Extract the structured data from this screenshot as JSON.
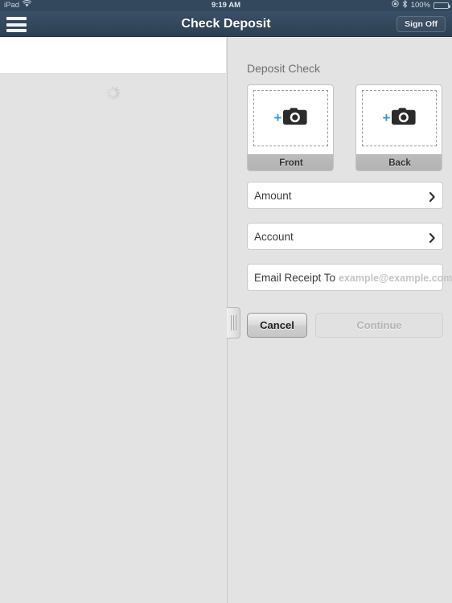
{
  "status_bar": {
    "device": "iPad",
    "wifi_icon": "wifi-icon",
    "time": "9:19 AM",
    "rotation_lock_icon": "rotation-lock-icon",
    "bluetooth_icon": "bluetooth-icon",
    "battery_percent": "100%",
    "battery_icon": "battery-full-icon"
  },
  "nav_bar": {
    "menu_icon": "hamburger-menu-icon",
    "title": "Check Deposit",
    "sign_off_label": "Sign Off"
  },
  "left_panel": {
    "spinner_icon": "loading-spinner-icon"
  },
  "deposit": {
    "heading": "Deposit Check",
    "captures": [
      {
        "label": "Front",
        "plus": "+",
        "camera_icon": "camera-icon"
      },
      {
        "label": "Back",
        "plus": "+",
        "camera_icon": "camera-icon"
      }
    ],
    "fields": [
      {
        "label": "Amount",
        "value": "",
        "placeholder": "",
        "accessory": "chevron-right-icon"
      },
      {
        "label": "Account",
        "value": "",
        "placeholder": "",
        "accessory": "chevron-right-icon"
      },
      {
        "label": "Email Receipt To",
        "value": "",
        "placeholder": "example@example.com",
        "accessory": ""
      }
    ],
    "cancel_label": "Cancel",
    "continue_label": "Continue",
    "continue_enabled": false
  },
  "split_handle": {
    "icon": "drag-handle-icon"
  },
  "colors": {
    "nav_bar": "#34485c",
    "status_bar": "#33485c",
    "page_background": "#e3e3e3",
    "accent_blue": "#2f95e8",
    "card_white": "#ffffff",
    "footer_gray": "#b6b6b6",
    "disabled_text": "#b4b4b4"
  }
}
